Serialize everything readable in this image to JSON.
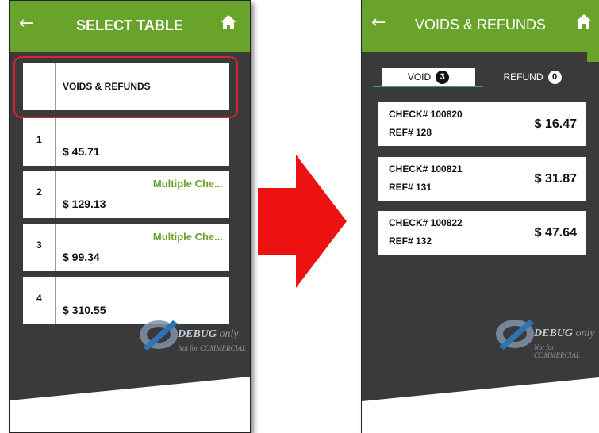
{
  "left_screen": {
    "header": {
      "title": "SELECT TABLE",
      "back_icon": "←",
      "home_icon": "🏠"
    },
    "rows": [
      {
        "number": "",
        "label": "VOIDS & REFUNDS",
        "amount": "",
        "note": ""
      },
      {
        "number": "1",
        "label": "",
        "amount": "$ 45.71",
        "note": ""
      },
      {
        "number": "2",
        "label": "",
        "amount": "$ 129.13",
        "note": "Multiple Che..."
      },
      {
        "number": "3",
        "label": "",
        "amount": "$ 99.34",
        "note": "Multiple Che..."
      },
      {
        "number": "4",
        "label": "",
        "amount": "$ 310.55",
        "note": ""
      }
    ]
  },
  "right_screen": {
    "header": {
      "title": "VOIDS & REFUNDS",
      "back_icon": "←",
      "home_icon": "🏠"
    },
    "tabs": [
      {
        "label": "VOID",
        "count": "3",
        "active": true
      },
      {
        "label": "REFUND",
        "count": "0",
        "active": false
      }
    ],
    "checks": [
      {
        "check": "CHECK# 100820",
        "ref": "REF# 128",
        "amount": "$ 16.47"
      },
      {
        "check": "CHECK# 100821",
        "ref": "REF# 131",
        "amount": "$ 31.87"
      },
      {
        "check": "CHECK# 100822",
        "ref": "REF# 132",
        "amount": "$ 47.64"
      }
    ]
  },
  "watermark": {
    "main": "DEBUG",
    "only": "only",
    "sub": "Not for COMMERCIAL"
  },
  "colors": {
    "accent": "#6aa32a",
    "background": "#3a3a3a",
    "arrow": "#ee1111",
    "highlight": "#d9232e",
    "tab_underline": "#2f9d8f"
  }
}
